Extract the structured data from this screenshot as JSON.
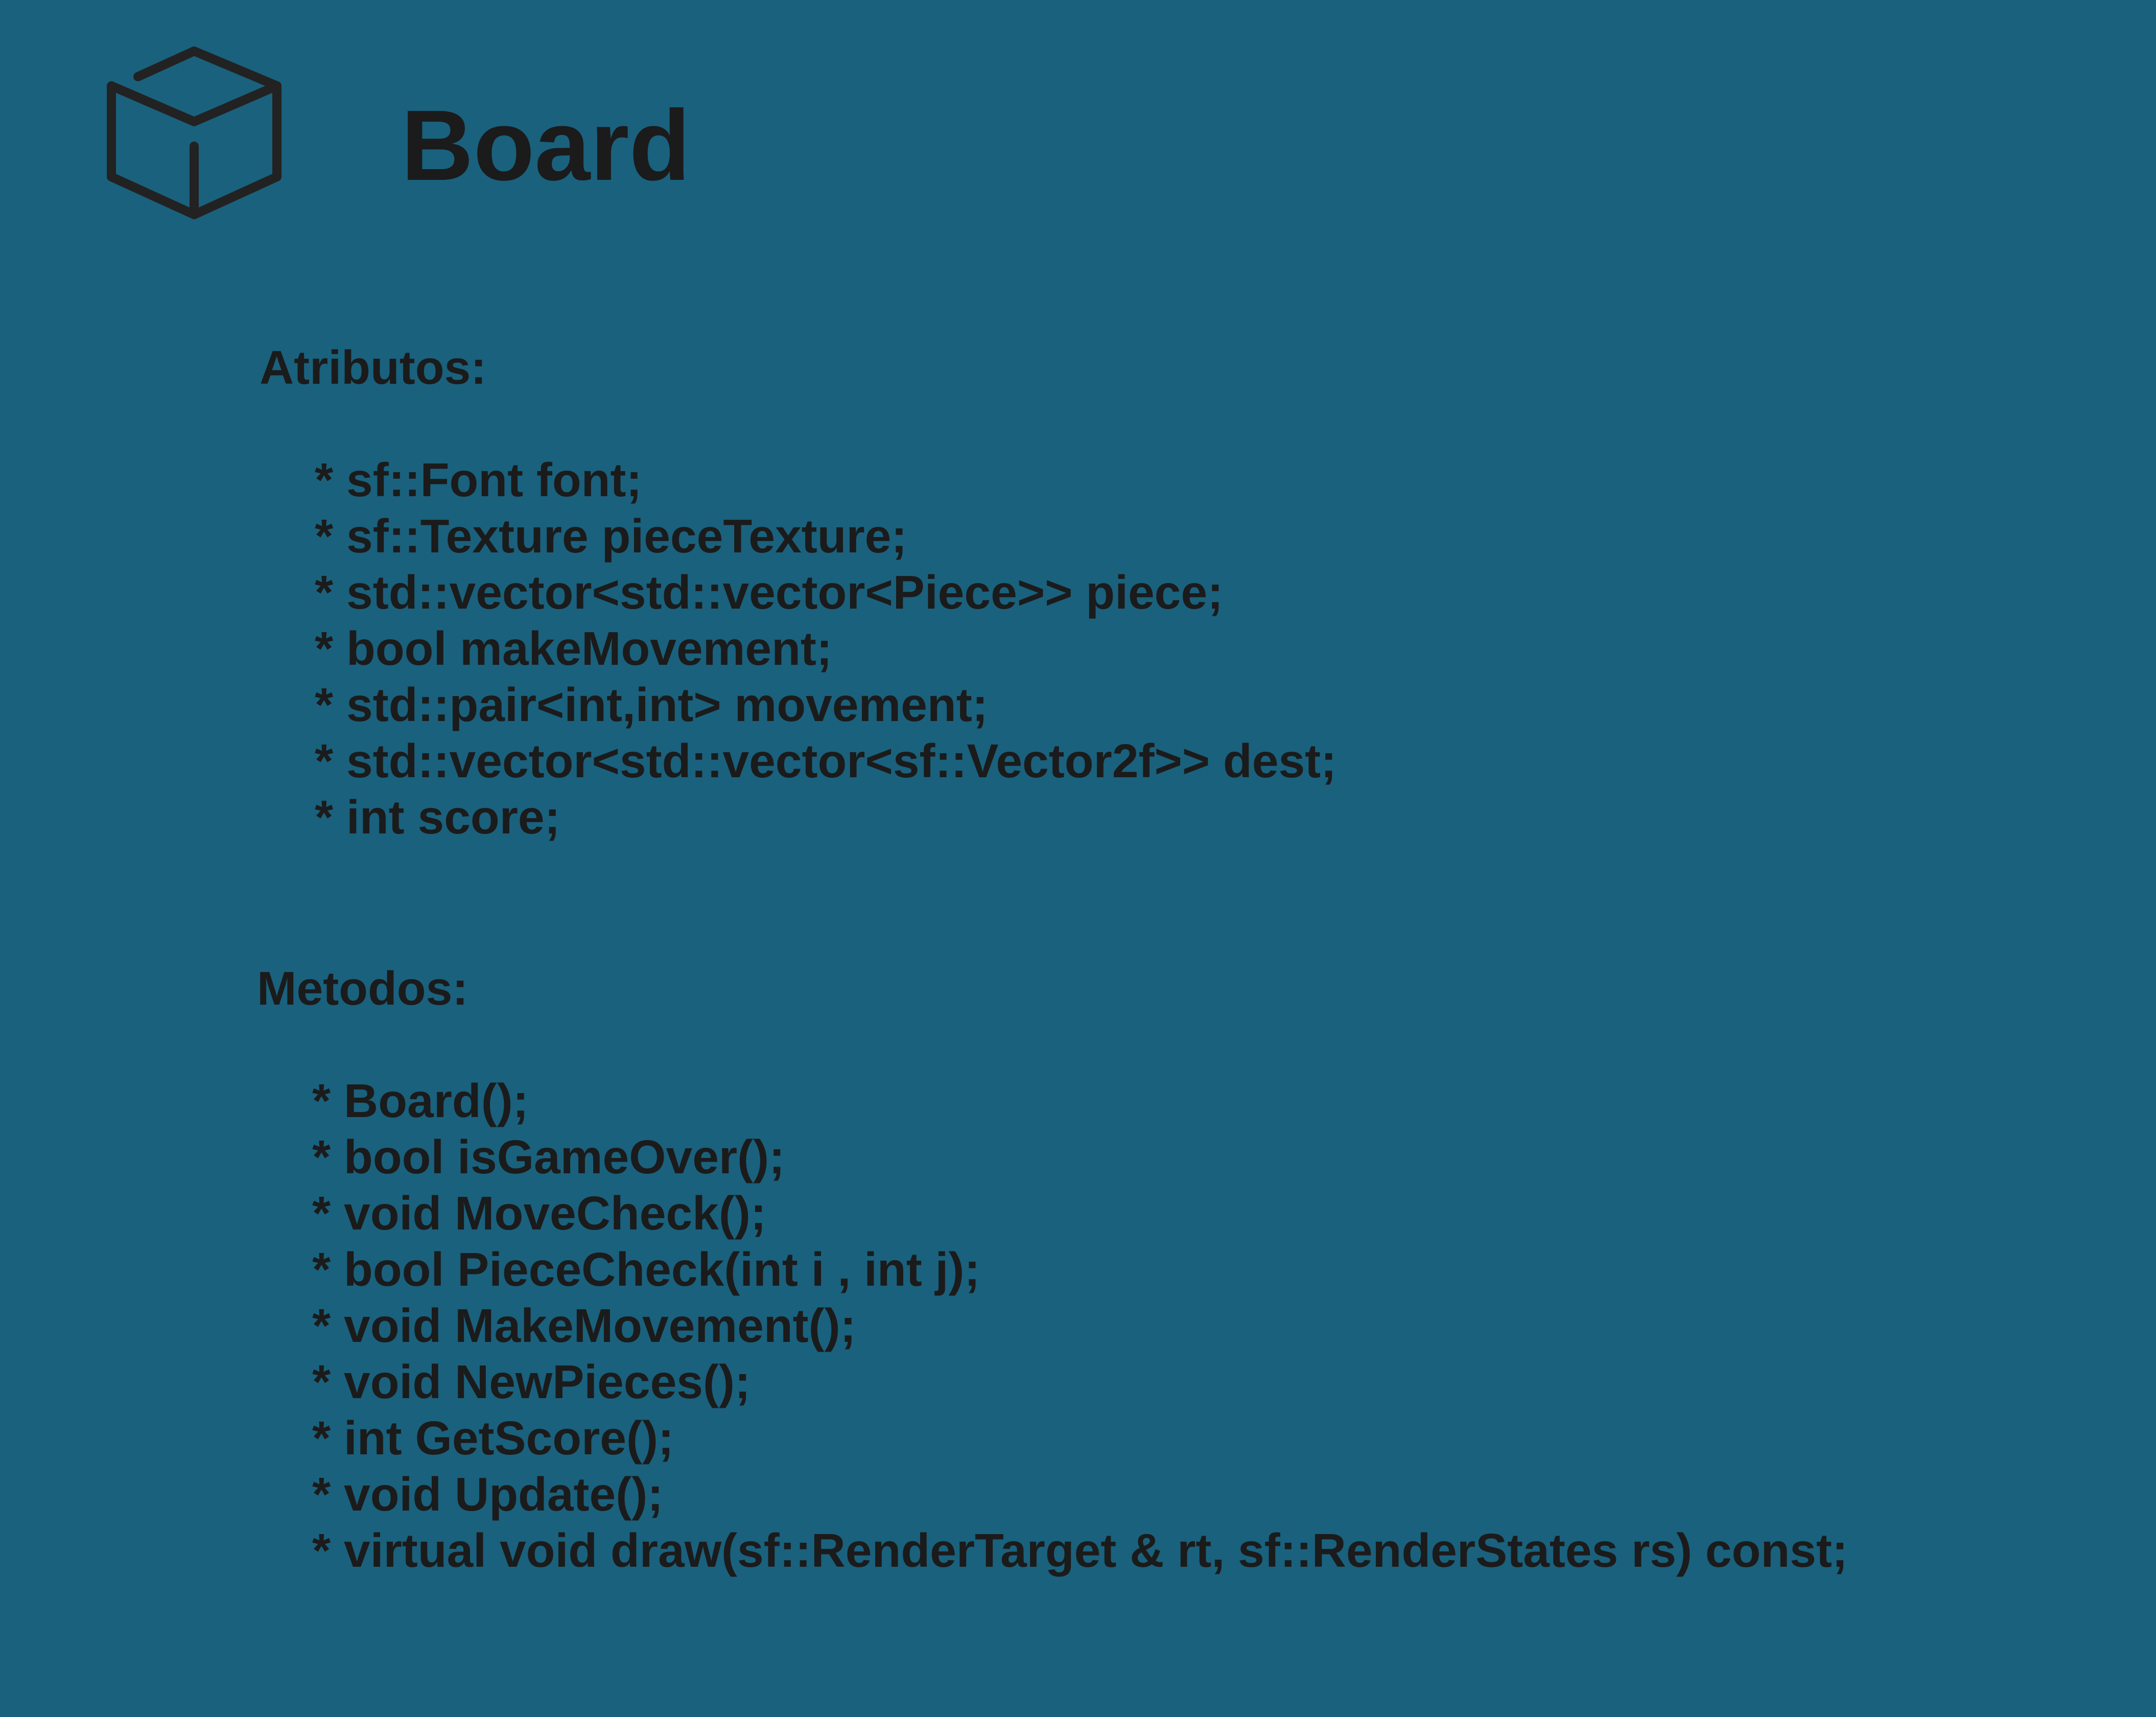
{
  "page": {
    "background_color": "#1a617d",
    "text_color": "#1b1b1b"
  },
  "header": {
    "icon": "cube-icon",
    "title": "Board"
  },
  "attributes": {
    "heading": "Atributos:",
    "items": [
      "* sf::Font font;",
      "* sf::Texture pieceTexture;",
      "* std::vector<std::vector<Piece>> piece;",
      "* bool makeMovement;",
      "* std::pair<int,int> movement;",
      "* std::vector<std::vector<sf::Vector2f>> dest;",
      "* int score;"
    ]
  },
  "methods": {
    "heading": "Metodos:",
    "items": [
      "* Board();",
      "* bool isGameOver();",
      "* void MoveCheck();",
      "* bool PieceCheck(int i , int j);",
      "* void MakeMovement();",
      "* void NewPieces();",
      "* int GetScore();",
      "* void Update();",
      "* virtual void draw(sf::RenderTarget & rt, sf::RenderStates rs) const;"
    ]
  }
}
